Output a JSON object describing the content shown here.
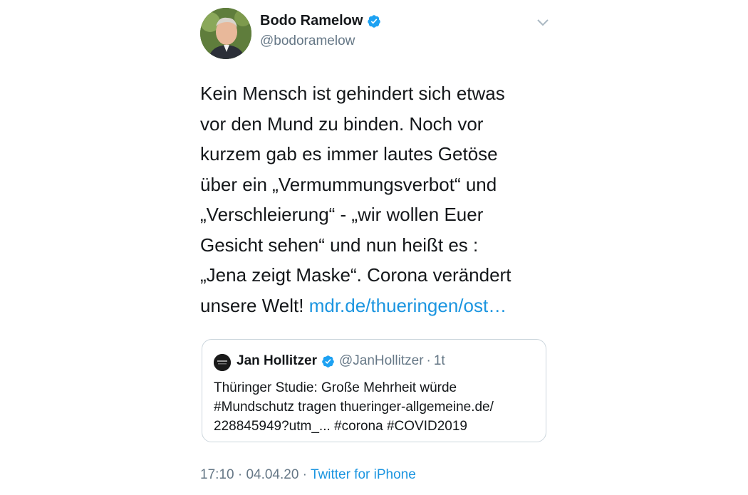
{
  "author": {
    "name": "Bodo Ramelow",
    "handle": "@bodoramelow",
    "verified": true
  },
  "tweet": {
    "lines": [
      "Kein Mensch ist gehindert sich etwas",
      "vor den Mund zu binden. Noch vor",
      "kurzem gab es immer lautes Getöse",
      "über ein „Vermummungsverbot“ und",
      "„Verschleierung“ - „wir wollen Euer",
      "Gesicht sehen“ und nun heißt es :",
      "„Jena zeigt Maske“. Corona verändert"
    ],
    "last_line_text": "unsere Welt! ",
    "link_text": "mdr.de/thueringen/ost…"
  },
  "quoted_tweet": {
    "name": "Jan Hollitzer",
    "handle": "@JanHollitzer",
    "separator": "·",
    "time": "1t",
    "lines": [
      "Thüringer Studie: Große Mehrheit würde",
      "#Mundschutz tragen thueringer-allgemeine.de/",
      "228845949?utm_... #corona #COVID2019"
    ]
  },
  "meta": {
    "time": "17:10",
    "separator1": " · ",
    "date": "04.04.20",
    "separator2": " · ",
    "source": "Twitter for iPhone"
  },
  "colors": {
    "text": "#14171a",
    "secondary": "#657786",
    "link": "#1b95e0",
    "verified": "#1da1f2",
    "border": "#ccd6dd"
  },
  "icons": {
    "verified": "verified-badge-icon",
    "caret": "chevron-down-icon"
  }
}
